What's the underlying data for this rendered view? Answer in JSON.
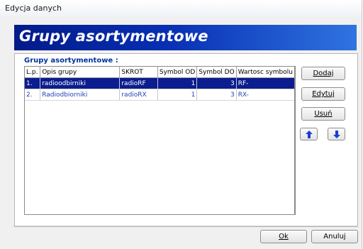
{
  "window": {
    "title": "Edycja danych"
  },
  "banner": {
    "title": "Grupy asortymentowe"
  },
  "section": {
    "label": "Grupy asortymentowe :"
  },
  "table": {
    "columns": [
      "L.p.",
      "Opis grupy",
      "SKROT",
      "Symbol OD",
      "Symbol DO",
      "Wartosc symbolu"
    ],
    "rows": [
      [
        "1.",
        "radioodbirniki",
        "radioRF",
        "1",
        "3",
        "RF-"
      ],
      [
        "2.",
        "Radiodbiorniki",
        "radioRX",
        "1",
        "3",
        "RX-"
      ]
    ],
    "selected_row": 0
  },
  "buttons": {
    "add": "Dodaj",
    "edit": "Edytuj",
    "delete": "Usuń",
    "ok": "Ok",
    "cancel": "Anuluj"
  },
  "colors": {
    "banner_dark": "#031b8a",
    "banner_light": "#2f74e0",
    "selection": "#0b1d8f",
    "row_text": "#1f3fb8",
    "arrow": "#1a3fd0"
  },
  "icons": {
    "move_up": "arrow-up-icon",
    "move_down": "arrow-down-icon"
  }
}
